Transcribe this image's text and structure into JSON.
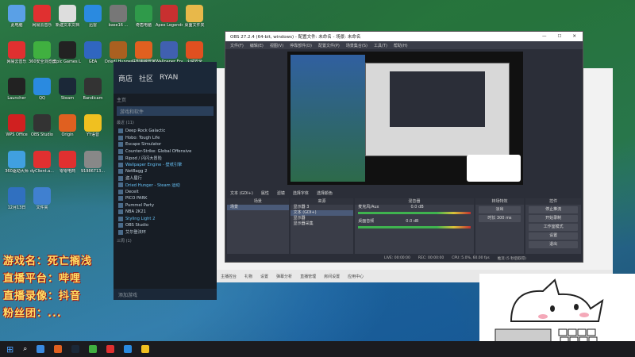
{
  "desktop_icons": [
    {
      "label": "此电脑",
      "color": "#5aa0e6"
    },
    {
      "label": "网易云音乐",
      "color": "#e03030"
    },
    {
      "label": "新建文本文档",
      "color": "#dddddd"
    },
    {
      "label": "迅雷",
      "color": "#2a8ae0"
    },
    {
      "label": "base16 ...",
      "color": "#777777"
    },
    {
      "label": "奇盾电脑",
      "color": "#2f9a4a"
    },
    {
      "label": "Apex Legends",
      "color": "#c83030"
    },
    {
      "label": "桌面文件夹",
      "color": "#e8b84a"
    },
    {
      "label": "网易云音乐",
      "color": "#e03030"
    },
    {
      "label": "360安全浏览器",
      "color": "#40b040"
    },
    {
      "label": "Epic Games Launcher",
      "color": "#222222"
    },
    {
      "label": "GEA",
      "color": "#3066c0"
    },
    {
      "label": "Driedl Hunger",
      "color": "#aa6020"
    },
    {
      "label": "联想电脑管家",
      "color": "#e06020"
    },
    {
      "label": "Wallpaper Engine",
      "color": "#4060b0"
    },
    {
      "label": "火绒安全",
      "color": "#e05020"
    },
    {
      "label": "Launcher",
      "color": "#222222"
    },
    {
      "label": "QQ",
      "color": "#2a8ae0"
    },
    {
      "label": "Steam",
      "color": "#1b2838"
    },
    {
      "label": "Bandicam",
      "color": "#333333"
    },
    {
      "label": "腾讯QQ",
      "color": "#2a8ae0"
    },
    {
      "label": "WPS Office",
      "color": "#d02020"
    },
    {
      "label": "OBS Studio",
      "color": "#333333"
    },
    {
      "label": "Origin",
      "color": "#e06020"
    },
    {
      "label": "YY语音",
      "color": "#f0c020"
    },
    {
      "label": "Ubisoft Connect",
      "color": "#2060c0"
    },
    {
      "label": "360驱动大师",
      "color": "#40a0e0"
    },
    {
      "label": "dyClient.a...",
      "color": "#e03030"
    },
    {
      "label": "零零电商",
      "color": "#e03030"
    },
    {
      "label": "91986713...",
      "color": "#888888"
    },
    {
      "label": "暴雪战网",
      "color": "#2060c0"
    },
    {
      "label": "12月13日",
      "color": "#3070c0"
    },
    {
      "label": "文件夹",
      "color": "#4080d0"
    }
  ],
  "banner_lines": [
    "游戏名：死亡搁浅",
    "直播平台：哔哩",
    "直播录像：抖音",
    "粉丝团：..."
  ],
  "steam": {
    "nav": [
      "商店",
      "社区",
      "RYAN"
    ],
    "library_label": "主页",
    "search_placeholder": "游戏和软件",
    "category": "最近 (11)",
    "games": [
      "Deep Rock Galactic",
      "Hobo: Tough Life",
      "Escape Simulator",
      "Counter-Strike: Global Offensive",
      "Ripod / 闪闪大冒险",
      "Wallpaper Engine - 壁纸引擎",
      "NetBagg 2",
      "盗人屋行",
      "Dried Hunger - Steam 运动",
      "Deceit",
      "PICO PARK",
      "Pummel Party",
      "NBA 2K21",
      "Styling Light 2",
      "OBS Studio",
      "艾尔登法环"
    ],
    "category2": "三周 (1)",
    "footer": "添加游戏"
  },
  "obs": {
    "title": "OBS 27.2.4 (64-bit, windows) - 配置文件: 未命名 - 场景: 未命名",
    "menu": [
      "文件(F)",
      "编辑(E)",
      "视图(V)",
      "停靠部件(D)",
      "配置文件(P)",
      "场景集合(S)",
      "工具(T)",
      "帮助(H)"
    ],
    "source_bar": [
      "文本 (GDI+)",
      "属性",
      "滤镜",
      "选择字体",
      "选择颜色"
    ],
    "docks": {
      "scenes": {
        "title": "场景",
        "items": [
          "场景"
        ]
      },
      "sources": {
        "title": "来源",
        "items": [
          "显示器 3",
          "文本 (GDI+)",
          "显示器",
          "显示器采集"
        ]
      },
      "mixer": {
        "title": "混音器",
        "items": [
          "麦克风/Aux",
          "桌面音频"
        ],
        "levels": [
          "0.0 dB",
          "0.0 dB"
        ]
      },
      "transitions": {
        "title": "转场特效",
        "items": [
          "淡出",
          "时长 300 ms"
        ]
      },
      "controls": {
        "title": "控件",
        "items": [
          "停止推流",
          "开始录制",
          "工作室模式",
          "设置",
          "退出"
        ]
      }
    },
    "status": [
      "LIVE: 00:00:00",
      "REC: 00:00:00",
      "CPU: 5.0%, 60.00 fps",
      "推流 (5 秒后取得)"
    ]
  },
  "browser_strip": [
    "主播控台",
    "礼物",
    "设置",
    "弹幕分析",
    "直播管理",
    "房间设置",
    "应用中心"
  ],
  "taskbar_colors": [
    "#3a8ae0",
    "#e06020",
    "#1b2838",
    "#40b040",
    "#e03030",
    "#2a8ae0",
    "#f0c020"
  ]
}
